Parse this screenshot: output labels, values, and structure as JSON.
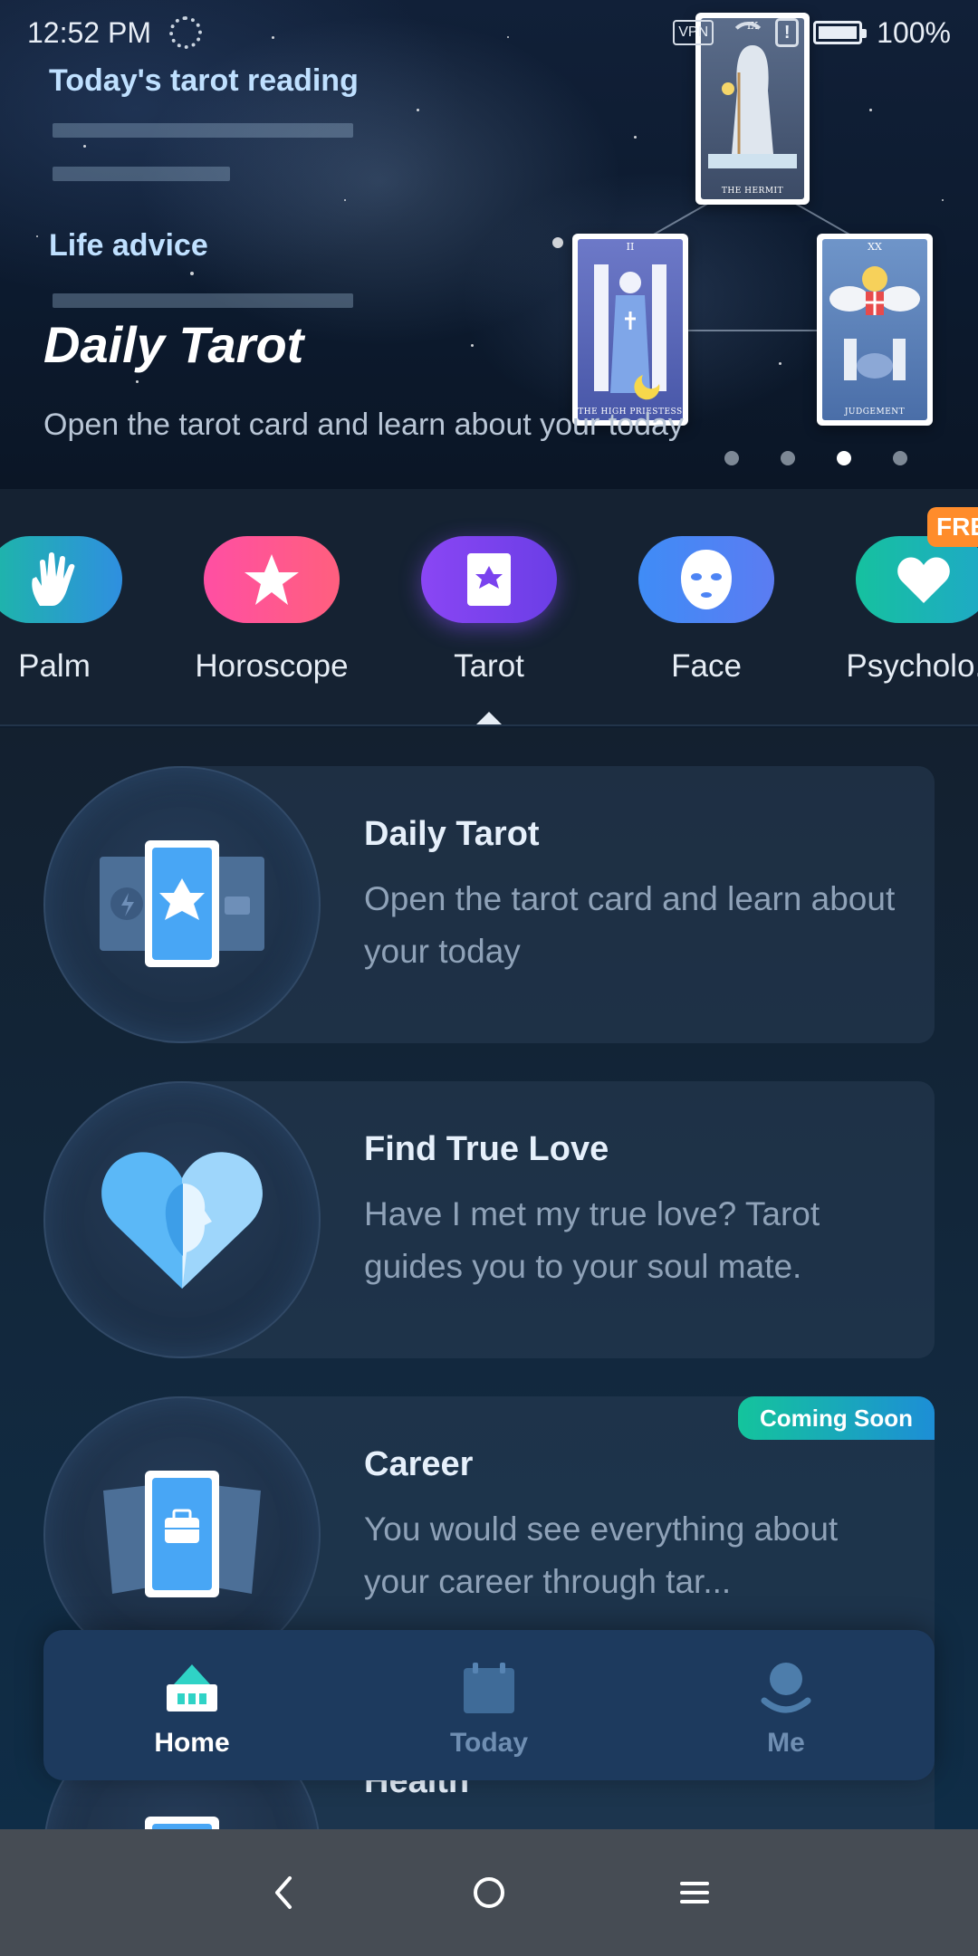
{
  "status_bar": {
    "time": "12:52 PM",
    "vpn": "VPN",
    "battery": "100%",
    "alert": "!"
  },
  "hero": {
    "reading_title": "Today's tarot reading",
    "advice_title": "Life advice",
    "title": "Daily Tarot",
    "subtitle": "Open the tarot card and learn about your today",
    "page_count": 4,
    "active_page": 3,
    "cards": [
      {
        "numeral": "IX",
        "name": "THE HERMIT"
      },
      {
        "numeral": "II",
        "name": "THE HIGH PRIESTESS"
      },
      {
        "numeral": "XX",
        "name": "JUDGEMENT"
      }
    ]
  },
  "categories": [
    {
      "label": "Palm",
      "icon": "hand-icon"
    },
    {
      "label": "Horoscope",
      "icon": "star-icon"
    },
    {
      "label": "Tarot",
      "icon": "tarot-card-icon",
      "selected": true
    },
    {
      "label": "Face",
      "icon": "face-mask-icon"
    },
    {
      "label": "Psycholo...",
      "icon": "heart-icon",
      "badge": "FREE"
    }
  ],
  "free_badge": "FRE",
  "features": [
    {
      "title": "Daily Tarot",
      "description": "Open the tarot card and learn about your today",
      "icon": "tarot-cards-icon"
    },
    {
      "title": "Find True Love",
      "description": "Have I met my true love? Tarot guides you to your soul mate.",
      "icon": "heart-face-icon"
    },
    {
      "title": "Career",
      "description": "You would see everything about your career through tar...",
      "badge": "Coming Soon",
      "icon": "briefcase-card-icon"
    },
    {
      "title": "Health",
      "icon": "tarot-card-icon"
    }
  ],
  "bottom_nav": [
    {
      "label": "Home",
      "icon": "home-icon",
      "active": true
    },
    {
      "label": "Today",
      "icon": "calendar-icon",
      "active": false
    },
    {
      "label": "Me",
      "icon": "user-icon",
      "active": false
    }
  ],
  "system_nav": {
    "back": "back-icon",
    "home": "home-circle-icon",
    "menu": "menu-icon"
  },
  "colors": {
    "background": "#0f1d2e",
    "accent_blue": "#bfe0ff",
    "tarot_purple": "#8a46f4",
    "badge_green": "#14c49c",
    "free_orange": "#ff8c2b",
    "nav_panel": "#1d3a5e"
  }
}
